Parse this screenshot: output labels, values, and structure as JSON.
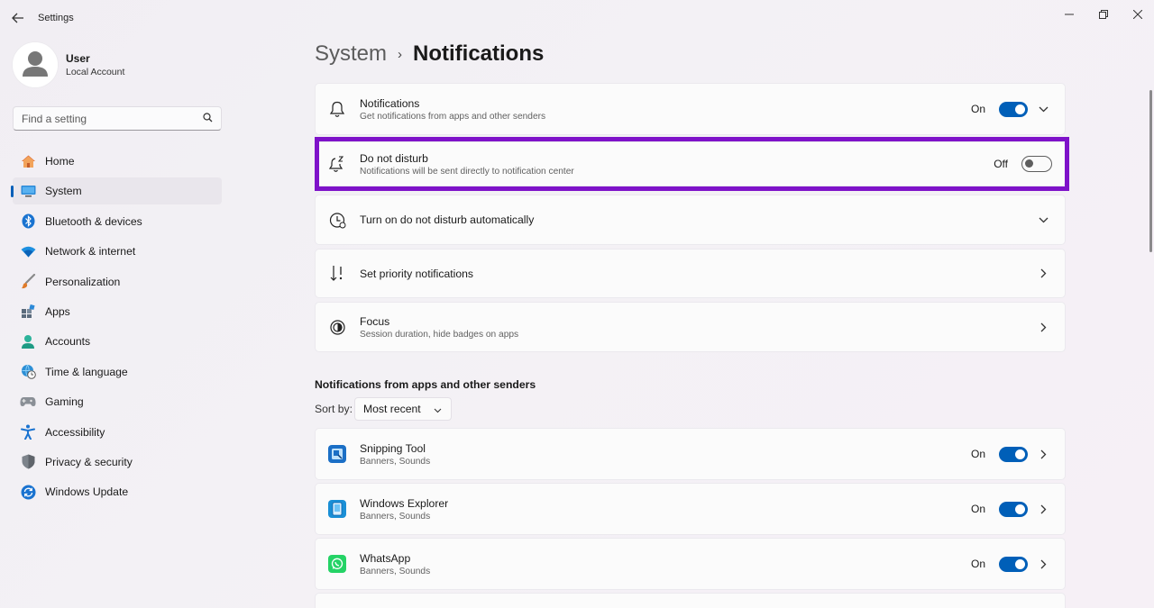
{
  "window": {
    "title": "Settings"
  },
  "user": {
    "name": "User",
    "account": "Local Account"
  },
  "search": {
    "placeholder": "Find a setting"
  },
  "nav": {
    "items": [
      {
        "label": "Home",
        "icon": "home-icon"
      },
      {
        "label": "System",
        "icon": "monitor-icon",
        "active": true
      },
      {
        "label": "Bluetooth & devices",
        "icon": "bluetooth-icon"
      },
      {
        "label": "Network & internet",
        "icon": "wifi-icon"
      },
      {
        "label": "Personalization",
        "icon": "brush-icon"
      },
      {
        "label": "Apps",
        "icon": "apps-icon"
      },
      {
        "label": "Accounts",
        "icon": "person-icon"
      },
      {
        "label": "Time & language",
        "icon": "globe-clock-icon"
      },
      {
        "label": "Gaming",
        "icon": "gamepad-icon"
      },
      {
        "label": "Accessibility",
        "icon": "accessibility-icon"
      },
      {
        "label": "Privacy & security",
        "icon": "shield-icon"
      },
      {
        "label": "Windows Update",
        "icon": "update-icon"
      }
    ]
  },
  "breadcrumb": {
    "parent": "System",
    "separator": "›",
    "current": "Notifications"
  },
  "settings": {
    "notifications": {
      "title": "Notifications",
      "subtitle": "Get notifications from apps and other senders",
      "state": "On"
    },
    "dnd": {
      "title": "Do not disturb",
      "subtitle": "Notifications will be sent directly to notification center",
      "state": "Off"
    },
    "dnd_auto": {
      "title": "Turn on do not disturb automatically"
    },
    "priority": {
      "title": "Set priority notifications"
    },
    "focus": {
      "title": "Focus",
      "subtitle": "Session duration, hide badges on apps"
    }
  },
  "apps_section": {
    "heading": "Notifications from apps and other senders",
    "sort_label": "Sort by:",
    "sort_value": "Most recent",
    "apps": [
      {
        "name": "Snipping Tool",
        "detail": "Banners, Sounds",
        "state": "On",
        "color": "#1b6fc6"
      },
      {
        "name": "Windows Explorer",
        "detail": "Banners, Sounds",
        "state": "On",
        "color": "#1a8fd6"
      },
      {
        "name": "WhatsApp",
        "detail": "Banners, Sounds",
        "state": "On",
        "color": "#25d366"
      }
    ]
  },
  "colors": {
    "accent": "#005fb8",
    "highlight": "#7e12c9"
  }
}
